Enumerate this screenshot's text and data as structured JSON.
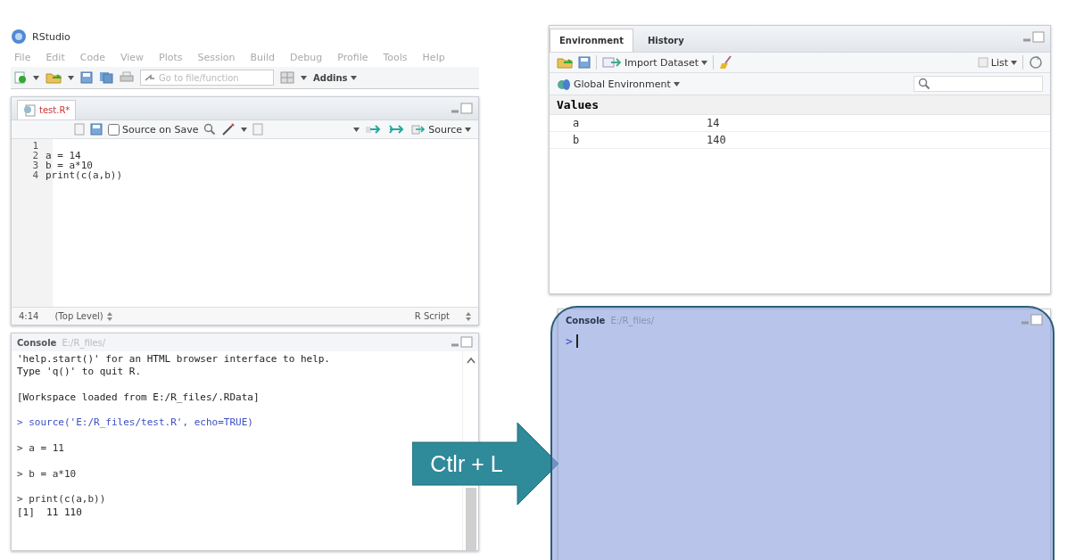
{
  "app": {
    "title": "RStudio",
    "menu": [
      "File",
      "Edit",
      "Code",
      "View",
      "Plots",
      "Session",
      "Build",
      "Debug",
      "Profile",
      "Tools",
      "Help"
    ],
    "goto_placeholder": "Go to file/function",
    "addins": "Addins"
  },
  "editor": {
    "tab": "test.R*",
    "source_on_save": {
      "label": "Source on Save",
      "checked": false
    },
    "source_button": "Source",
    "lines": [
      {
        "number": "1"
      },
      {
        "number": "2",
        "code": "a = 14"
      },
      {
        "number": "3",
        "code": "b = a*10"
      },
      {
        "number": "4",
        "code": "print(c(a,b))"
      }
    ],
    "status": {
      "position": "4:14",
      "scope": "(Top Level)",
      "file_type": "R Script"
    }
  },
  "console_left": {
    "title": "Console",
    "path": "E:/R_files/",
    "lines": [
      {
        "kind": "output",
        "text": "'help.start()' for an HTML browser interface to help."
      },
      {
        "kind": "output",
        "text": "Type 'q()' to quit R."
      },
      {
        "kind": "blank"
      },
      {
        "kind": "output",
        "text": "[Workspace loaded from E:/R_files/.RData]"
      },
      {
        "kind": "blank"
      },
      {
        "kind": "command",
        "text": "> source('E:/R_files/test.R', echo=TRUE)"
      },
      {
        "kind": "blank"
      },
      {
        "kind": "echo",
        "text": "> a = 11"
      },
      {
        "kind": "blank"
      },
      {
        "kind": "echo",
        "text": "> b = a*10"
      },
      {
        "kind": "blank"
      },
      {
        "kind": "echo",
        "text": "> print(c(a,b))"
      },
      {
        "kind": "output",
        "text": "[1]  11 110"
      }
    ]
  },
  "environment": {
    "tabs": [
      {
        "label": "Environment",
        "selected": true
      },
      {
        "label": "History",
        "selected": false
      }
    ],
    "import_dataset": "Import Dataset",
    "view_mode": "List",
    "scope": "Global Environment",
    "section": "Values",
    "rows": [
      {
        "name": "a",
        "value": "14"
      },
      {
        "name": "b",
        "value": "140"
      }
    ]
  },
  "console_right": {
    "title": "Console",
    "path": "E:/R_files/",
    "prompt": ">",
    "highlighted": true
  },
  "callout": {
    "text": "Ctlr + L"
  }
}
